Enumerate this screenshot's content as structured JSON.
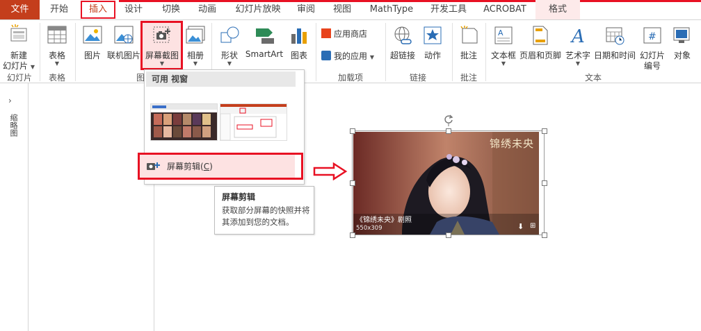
{
  "tabs": [
    {
      "id": "file",
      "label": "文件"
    },
    {
      "id": "home",
      "label": "开始"
    },
    {
      "id": "insert",
      "label": "插入"
    },
    {
      "id": "design",
      "label": "设计"
    },
    {
      "id": "transitions",
      "label": "切换"
    },
    {
      "id": "animations",
      "label": "动画"
    },
    {
      "id": "slideshow",
      "label": "幻灯片放映"
    },
    {
      "id": "review",
      "label": "审阅"
    },
    {
      "id": "view",
      "label": "视图"
    },
    {
      "id": "mathtype",
      "label": "MathType"
    },
    {
      "id": "developer",
      "label": "开发工具"
    },
    {
      "id": "acrobat",
      "label": "ACROBAT"
    },
    {
      "id": "format",
      "label": "格式"
    }
  ],
  "ribbon": {
    "new_slide_line1": "新建",
    "new_slide_line2": "幻灯片",
    "table": "表格",
    "picture": "图片",
    "online_picture": "联机图片",
    "screenshot": "屏幕截图",
    "album": "相册",
    "shapes": "形状",
    "smartart": "SmartArt",
    "chart": "图表",
    "app_store": "应用商店",
    "my_apps": "我的应用",
    "hyperlink": "超链接",
    "action": "动作",
    "comment": "批注",
    "textbox": "文本框",
    "header_footer": "页眉和页脚",
    "wordart": "艺术字",
    "datetime": "日期和时间",
    "slide_number_line1": "幻灯片",
    "slide_number_line2": "编号",
    "object": "对象",
    "groups": {
      "slides": "幻灯片",
      "tables": "表格",
      "images": "图",
      "addins": "加载项",
      "links": "链接",
      "comments": "批注",
      "text": "文本"
    }
  },
  "left_pane": {
    "label": "缩略图"
  },
  "dropdown": {
    "header": "可用 视窗",
    "clip_label": "屏幕剪辑(",
    "clip_key": "C",
    "clip_close": ")"
  },
  "tooltip": {
    "title": "屏幕剪辑",
    "description": "获取部分屏幕的快照并将其添加到您的文档。"
  },
  "image": {
    "title_overlay": "锦绣未央",
    "caption": "《锦绣未央》剧照",
    "size": "550x309"
  },
  "colors": {
    "accent": "#c43e1c",
    "highlight": "#e81123"
  }
}
